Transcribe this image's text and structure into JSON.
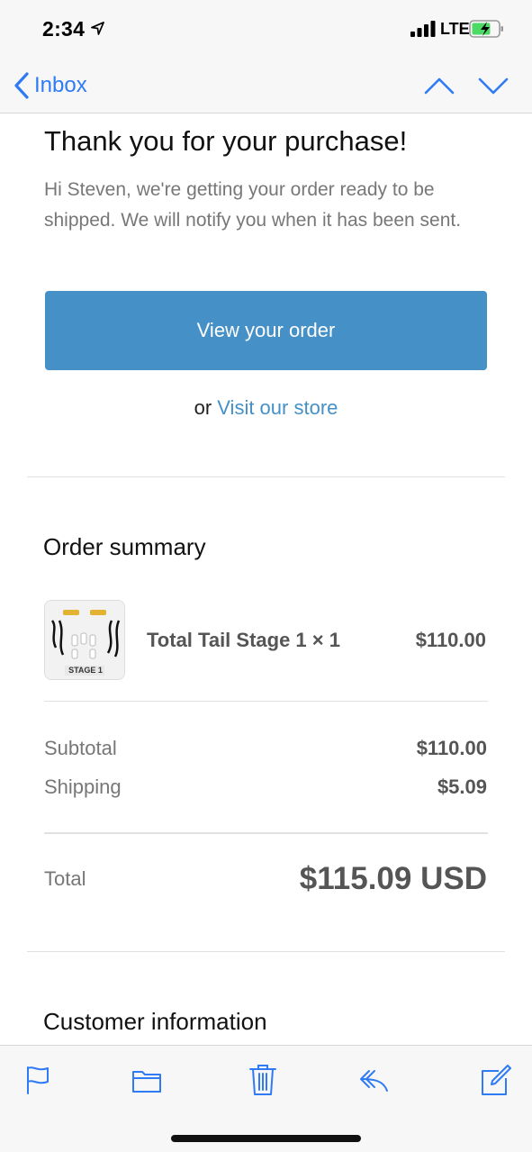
{
  "status_bar": {
    "time": "2:34",
    "network": "LTE",
    "icons": [
      "location-arrow-icon",
      "cellular-signal-icon",
      "battery-charging-icon"
    ]
  },
  "nav": {
    "back_label": "Inbox",
    "icons": [
      "chevron-left-icon",
      "chevron-up-icon",
      "chevron-down-icon"
    ]
  },
  "email": {
    "title": "Thank you for your purchase!",
    "intro": "Hi Steven, we're getting your order ready to be shipped. We will notify you when it has been sent.",
    "view_order_label": "View your order",
    "or_text": "or",
    "store_link": "Visit our store"
  },
  "order_summary": {
    "heading": "Order summary",
    "item": {
      "name": "Total Tail Stage 1 × 1",
      "price": "$110.00",
      "image_caption": "STAGE 1"
    },
    "subtotal_label": "Subtotal",
    "subtotal_value": "$110.00",
    "shipping_label": "Shipping",
    "shipping_value": "$5.09",
    "total_label": "Total",
    "total_value": "$115.09 USD"
  },
  "customer_info": {
    "heading": "Customer information"
  },
  "toolbar": {
    "icons": [
      "flag-icon",
      "folder-icon",
      "trash-icon",
      "reply-icon",
      "compose-icon"
    ]
  },
  "colors": {
    "accent_ios": "#2f7bf5",
    "button_blue": "#4590c6",
    "body_gray": "#777777",
    "value_gray": "#555555"
  }
}
